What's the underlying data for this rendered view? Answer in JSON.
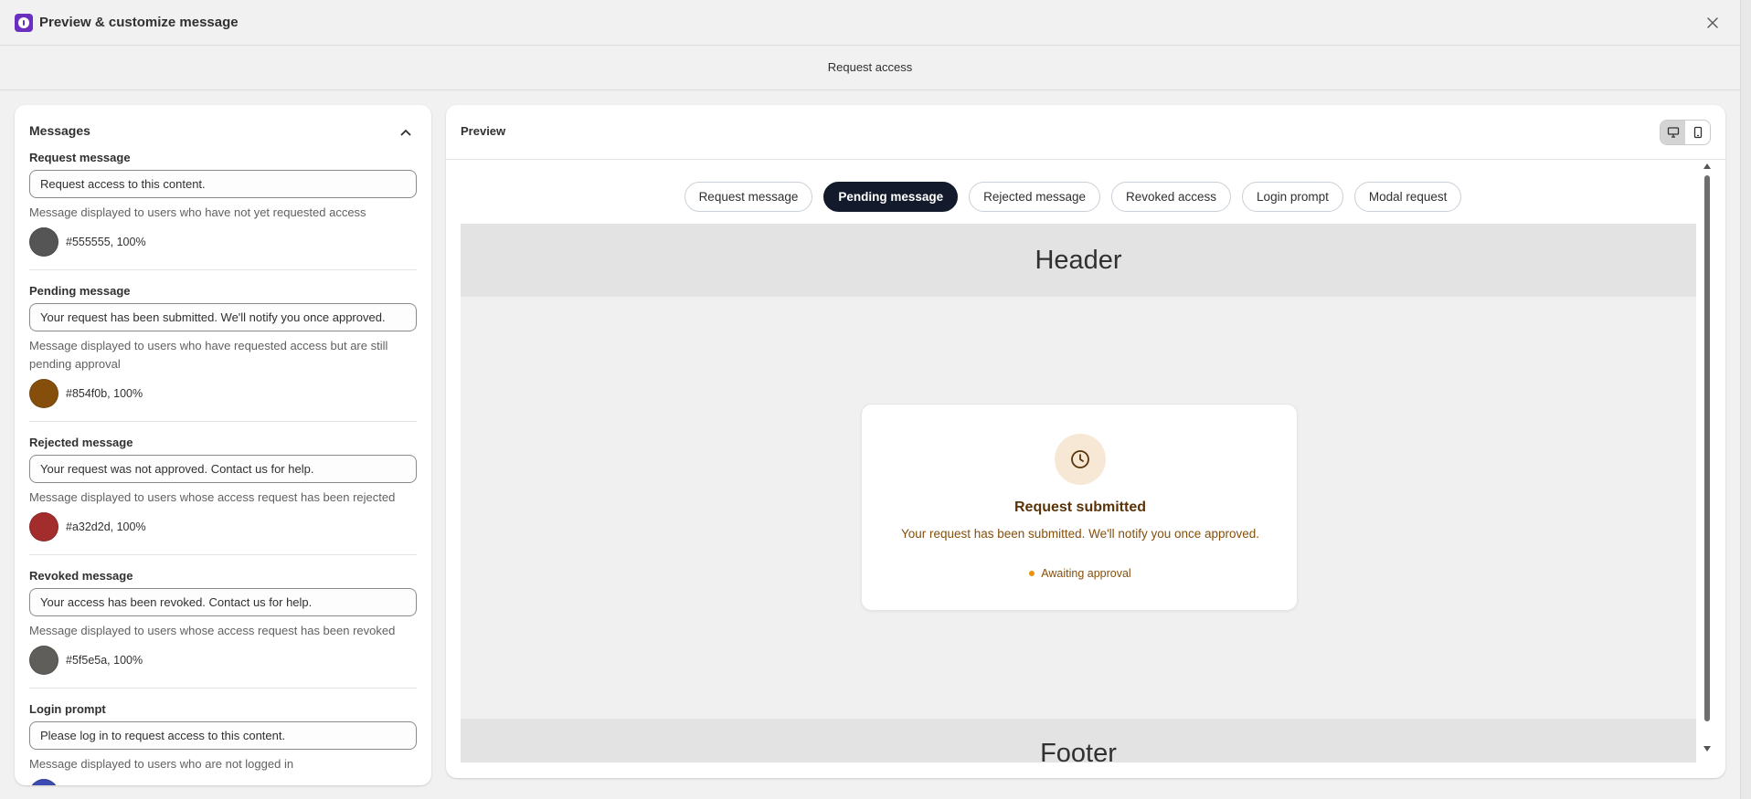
{
  "window": {
    "title": "Preview & customize message",
    "subtitle": "Request access"
  },
  "icons": {
    "app_logo": "purple-lock-icon",
    "close": "close-icon",
    "collapse": "chevron-up-icon",
    "desktop": "desktop-icon",
    "mobile": "mobile-icon",
    "clock": "clock-icon"
  },
  "messages_panel": {
    "title": "Messages",
    "sections": [
      {
        "label": "Request message",
        "value": "Request access to this content.",
        "help": "Message displayed to users who have not yet requested access",
        "color_hex": "#555555",
        "color_text": "#555555, 100%"
      },
      {
        "label": "Pending message",
        "value": "Your request has been submitted. We'll notify you once approved.",
        "help": "Message displayed to users who have requested access but are still pending approval",
        "color_hex": "#854f0b",
        "color_text": "#854f0b, 100%"
      },
      {
        "label": "Rejected message",
        "value": "Your request was not approved. Contact us for help.",
        "help": "Message displayed to users whose access request has been rejected",
        "color_hex": "#a32d2d",
        "color_text": "#a32d2d, 100%"
      },
      {
        "label": "Revoked message",
        "value": "Your access has been revoked. Contact us for help.",
        "help": "Message displayed to users whose access request has been revoked",
        "color_hex": "#5f5e5a",
        "color_text": "#5f5e5a, 100%"
      },
      {
        "label": "Login prompt",
        "value": "Please log in to request access to this content.",
        "help": "Message displayed to users who are not logged in",
        "color_hex": "#3b4bb0"
      }
    ]
  },
  "preview": {
    "title": "Preview",
    "device_active": "desktop",
    "tabs": [
      "Request message",
      "Pending message",
      "Rejected message",
      "Revoked access",
      "Login prompt",
      "Modal request"
    ],
    "active_tab": "Pending message",
    "header_text": "Header",
    "footer_text": "Footer",
    "card": {
      "title": "Request submitted",
      "text": "Your request has been submitted. We'll notify you once approved.",
      "status": "Awaiting approval",
      "accent": "#854f0b",
      "dot_color": "#e8930c"
    }
  }
}
